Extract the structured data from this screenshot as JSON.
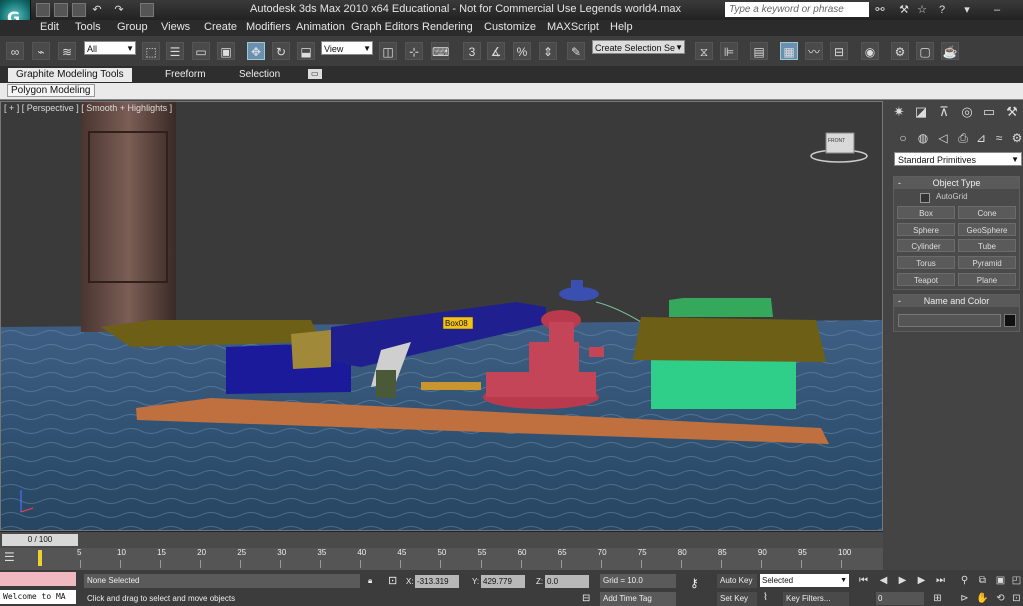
{
  "app": {
    "title": "Autodesk 3ds Max  2010 x64   Educational - Not for Commercial Use     Legends world4.max"
  },
  "menu": [
    "Edit",
    "Tools",
    "Group",
    "Views",
    "Create",
    "Modifiers",
    "Animation",
    "Graph Editors",
    "Rendering",
    "Customize",
    "MAXScript",
    "Help"
  ],
  "search": {
    "placeholder": "Type a keyword or phrase"
  },
  "toolbar": {
    "filter_value": "All",
    "coord_value": "View",
    "selection_set_value": "Create Selection Se",
    "snap_value": "3"
  },
  "ribbon": {
    "tabs": [
      "Graphite Modeling Tools",
      "Freeform",
      "Selection"
    ],
    "panel_label": "Polygon Modeling"
  },
  "viewport": {
    "label": "[ + ] [ Perspective ] [ Smooth + Highlights ]",
    "object_label": "Box08",
    "viewcube_label": "FRONT"
  },
  "command_panel": {
    "dropdown": "Standard Primitives",
    "object_type": {
      "header": "Object Type",
      "autogrid": "AutoGrid",
      "buttons": [
        "Box",
        "Cone",
        "Sphere",
        "GeoSphere",
        "Cylinder",
        "Tube",
        "Torus",
        "Pyramid",
        "Teapot",
        "Plane"
      ]
    },
    "name_color": {
      "header": "Name and Color",
      "color": "#111111"
    }
  },
  "timeline": {
    "frame": "0 / 100",
    "ticks": [
      "5",
      "10",
      "15",
      "20",
      "25",
      "30",
      "35",
      "40",
      "45",
      "50",
      "55",
      "60",
      "65",
      "70",
      "75",
      "80",
      "85",
      "90",
      "95",
      "100"
    ]
  },
  "status": {
    "maxscript": "Welcome to MA",
    "selection": "None Selected",
    "prompt": "Click and drag to select and move objects",
    "x_label": "X:",
    "x_value": "-313.319",
    "y_label": "Y:",
    "y_value": "429.779",
    "z_label": "Z:",
    "z_value": "0.0",
    "grid": "Grid = 10.0",
    "add_time_tag": "Add Time Tag",
    "auto_key": "Auto Key",
    "auto_key_value": "Selected",
    "set_key": "Set Key",
    "key_filters": "Key Filters...",
    "frame_value": "0"
  },
  "colors": {
    "accent": "#2a8f8f",
    "water": "#2e4a6a"
  }
}
